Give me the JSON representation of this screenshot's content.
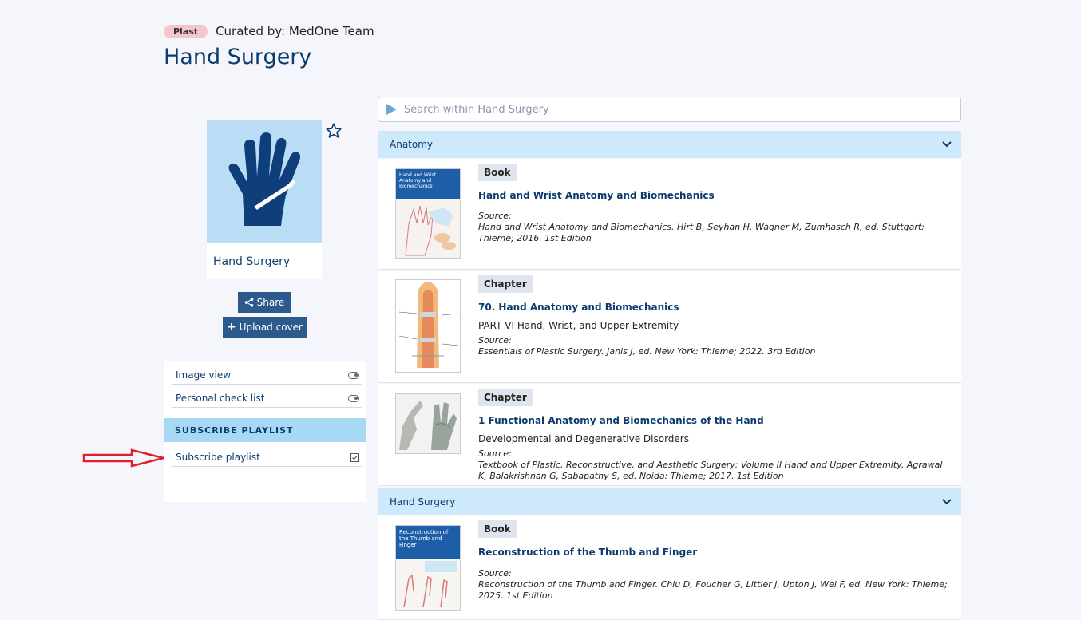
{
  "header": {
    "tag": "Plast",
    "curated": "Curated by: MedOne Team",
    "title": "Hand Surgery"
  },
  "cover": {
    "title": "Hand Surgery",
    "icon": "hand-icon"
  },
  "buttons": {
    "share": "Share",
    "upload": "Upload cover"
  },
  "options": {
    "image_view": "Image view",
    "check_list": "Personal check list",
    "subscribe_header": "SUBSCRIBE PLAYLIST",
    "subscribe": "Subscribe playlist"
  },
  "search": {
    "placeholder": "Search within Hand Surgery"
  },
  "sections": [
    {
      "name": "Anatomy",
      "items": [
        {
          "type": "Book",
          "title": "Hand and Wrist Anatomy and Biomechanics",
          "subtitle": "",
          "source_label": "Source:",
          "source": "Hand and Wrist Anatomy and Biomechanics. Hirt B, Seyhan H, Wagner M, Zumhasch R, ed. Stuttgart: Thieme; 2016. 1st Edition"
        },
        {
          "type": "Chapter",
          "title": "70. Hand Anatomy and Biomechanics",
          "subtitle": "PART VI Hand, Wrist, and Upper Extremity",
          "source_label": "Source:",
          "source": "Essentials of Plastic Surgery. Janis J, ed. New York: Thieme; 2022. 3rd Edition"
        },
        {
          "type": "Chapter",
          "title": "1 Functional Anatomy and Biomechanics of the Hand",
          "subtitle": "Developmental and Degenerative Disorders",
          "source_label": "Source:",
          "source": "Textbook of Plastic, Reconstructive, and Aesthetic Surgery: Volume II Hand and Upper Extremity. Agrawal K, Balakrishnan G, Sabapathy S, ed. Noida: Thieme; 2017. 1st Edition"
        }
      ]
    },
    {
      "name": "Hand Surgery",
      "items": [
        {
          "type": "Book",
          "title": "Reconstruction of the Thumb and Finger",
          "subtitle": "",
          "source_label": "Source:",
          "source": "Reconstruction of the Thumb and Finger. Chiu D, Foucher G, Littler J, Upton J, Wei F, ed. New York: Thieme; 2025. 1st Edition"
        }
      ]
    }
  ],
  "thumbs": {
    "book1_title": "Hand and Wrist Anatomy and Biomechanics",
    "book2_title": "Reconstruction of the Thumb and Finger"
  },
  "colors": {
    "brand": "#0d3b6e",
    "accent": "#2d5a8d",
    "section": "#cde9fb",
    "tag": "#f5c6cc"
  }
}
